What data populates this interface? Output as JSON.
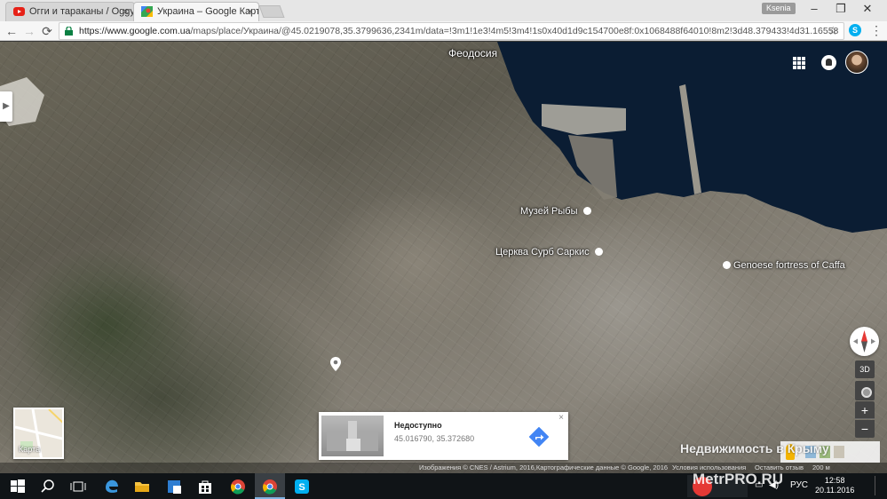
{
  "browser": {
    "tabs": [
      {
        "title": "Огги и тараканы / Oggy",
        "favicon": "youtube-icon",
        "close": "×"
      },
      {
        "title": "Украина – Google Карты",
        "favicon": "google-maps-icon",
        "close": "×"
      }
    ],
    "user_name": "Ksenia",
    "window_controls": {
      "minimize": "–",
      "restore": "❐",
      "close": "✕"
    },
    "url_prefix": "https://www.google.com.ua",
    "url_path": "/maps/place/Украина/@45.0219078,35.3799636,2341m/data=!3m1!1e3!4m5!3m4!1s0x40d1d9c154700e8f:0x1068488f64010!8m2!3d48.379433!4d31.16558",
    "nav": {
      "back": "←",
      "forward": "→",
      "reload": "⟳"
    },
    "bookmark_star": "☆",
    "menu": "⋮",
    "skype_ext": "S"
  },
  "map": {
    "view": "satellite",
    "labels": {
      "city": "Феодосия",
      "poi_museum": "Музей Рыбы",
      "poi_church": "Церква Сурб Саркис",
      "poi_fortress": "Genoese fortress of Caffa"
    },
    "minimap_label": "Карта",
    "controls": {
      "three_d": "3D",
      "zoom_in": "+",
      "zoom_out": "−"
    },
    "info_card": {
      "title": "Недоступно",
      "coords": "45.016790, 35.372680",
      "close": "×"
    },
    "footer": {
      "imagery": "Изображения © CNES / Astrium, 2016,Картографические данные © Google, 2016",
      "terms": "Условия использования",
      "feedback": "Оставить отзыв",
      "scale": "200 м"
    },
    "watermark": "Недвижимость в Крыму"
  },
  "taskbar": {
    "language": "РУС",
    "time": "12:58",
    "date": "20.11.2016",
    "watermark": "MetrPRO.RU"
  },
  "colors": {
    "sea": "#0b1d33",
    "chrome_tab_bar": "#e6e6e6",
    "taskbar": "#101417",
    "directions_blue": "#4285f4"
  }
}
